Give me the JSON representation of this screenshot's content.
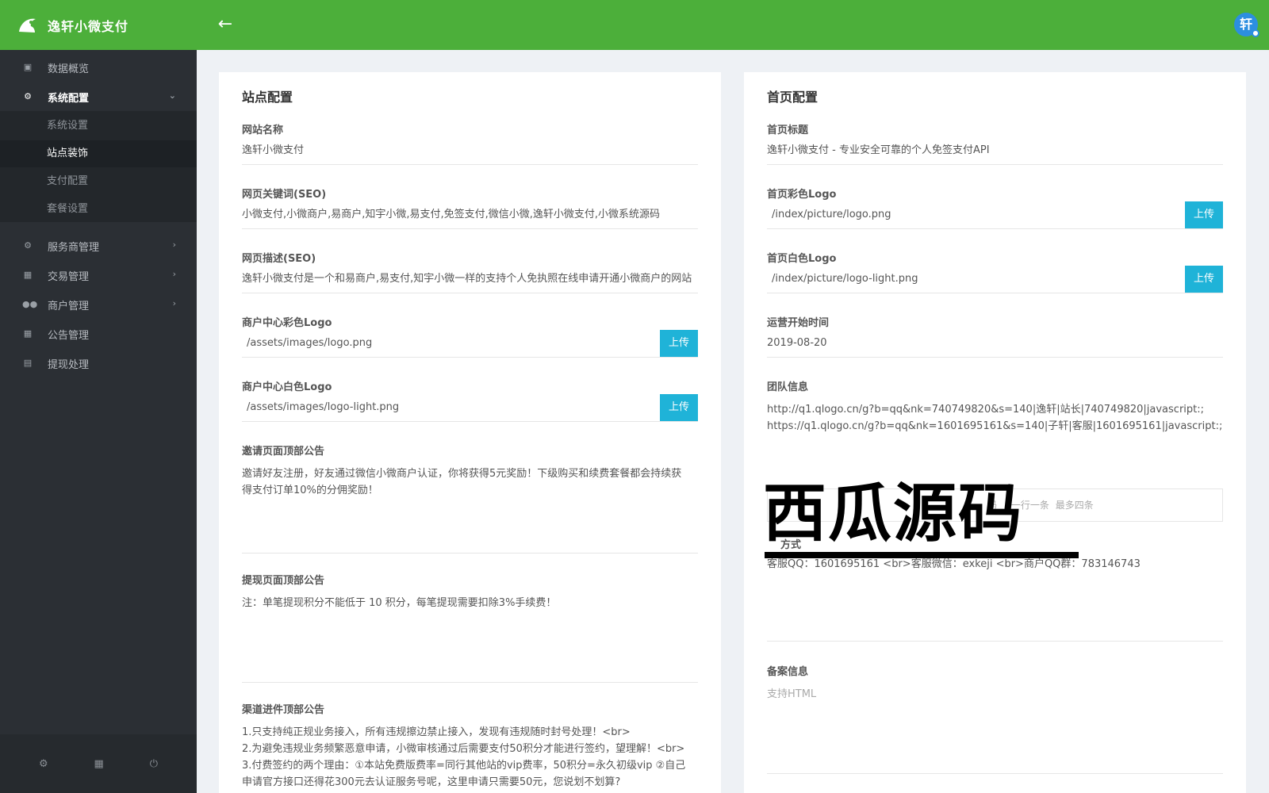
{
  "header": {
    "brand_title": "逸轩小微支付",
    "back_icon": "arrow-left-icon",
    "avatar_text": "轩"
  },
  "colors": {
    "header": "#4caf3a",
    "sidebar": "#2b2f34",
    "upload_button": "#1fb3d8"
  },
  "sidebar": {
    "items": [
      {
        "label": "数据概览",
        "icon": "window-icon"
      },
      {
        "label": "系统配置",
        "icon": "gear-icon"
      },
      {
        "label": "服务商管理",
        "icon": "gear-icon"
      },
      {
        "label": "交易管理",
        "icon": "calendar-icon"
      },
      {
        "label": "商户管理",
        "icon": "users-icon"
      },
      {
        "label": "公告管理",
        "icon": "calendar-icon"
      },
      {
        "label": "提现处理",
        "icon": "money-icon"
      }
    ],
    "submenu": [
      {
        "label": "系统设置"
      },
      {
        "label": "站点装饰"
      },
      {
        "label": "支付配置"
      },
      {
        "label": "套餐设置"
      }
    ],
    "footer": [
      "gear-icon",
      "calendar-icon",
      "power-icon"
    ]
  },
  "site_config": {
    "title": "站点配置",
    "site_name_label": "网站名称",
    "site_name_value": "逸轩小微支付",
    "keywords_label": "网页关键词(SEO)",
    "keywords_value": "小微支付,小微商户,易商户,知宇小微,易支付,免签支付,微信小微,逸轩小微支付,小微系统源码",
    "description_label": "网页描述(SEO)",
    "description_value": "逸轩小微支付是一个和易商户,易支付,知宇小微一样的支持个人免执照在线申请开通小微商户的网站",
    "color_logo_label": "商户中心彩色Logo",
    "color_logo_value": "/assets/images/logo.png",
    "white_logo_label": "商户中心白色Logo",
    "white_logo_value": "/assets/images/logo-light.png",
    "upload_label": "上传",
    "invite_label": "邀请页面顶部公告",
    "invite_line1": "邀请好友注册，好友通过微信小微商户认证，你将获得5元奖励！下级购买和续费套餐都会持续获",
    "invite_line2": "得支付订单10%的分佣奖励！",
    "withdraw_label": "提现页面顶部公告",
    "withdraw_value": "注：单笔提现积分不能低于 10 积分，每笔提现需要扣除3%手续费！",
    "channel_label": "渠道进件顶部公告",
    "channel_line1": "1.只支持纯正规业务接入，所有违规擦边禁止接入，发现有违规随时封号处理！<br>",
    "channel_line2": "2.为避免违规业务频繁恶意申请，小微审核通过后需要支付50积分才能进行签约，望理解！<br>",
    "channel_line3": "3.付费签约的两个理由：①本站免费版费率=同行其他站的vip费率，50积分=永久初级vip ②自己",
    "channel_line4": "申请官方接口还得花300元去认证服务号呢，这里申请只需要50元，您说划不划算?"
  },
  "home_config": {
    "title": "首页配置",
    "home_title_label": "首页标题",
    "home_title_value": "逸轩小微支付 - 专业安全可靠的个人免签支付API",
    "color_logo_label": "首页彩色Logo",
    "color_logo_value": "/index/picture/logo.png",
    "white_logo_label": "首页白色Logo",
    "white_logo_value": "/index/picture/logo-light.png",
    "upload_label": "上传",
    "start_label": "运营开始时间",
    "start_value": "2019-08-20",
    "team_label": "团队信息",
    "team_line1": "http://q1.qlogo.cn/g?b=qq&nk=740749820&s=140|逸轩|站长|740749820|javascript:;",
    "team_line2": "https://q1.qlogo.cn/g?b=qq&nk=1601695161&s=140|子轩|客服|1601695161|javascript:;",
    "hidden_input_fragments": [
      "码",
      "一行一条",
      "最多四条"
    ],
    "contact_label_fragment": "方式",
    "contact_value": "客服QQ：1601695161 <br>客服微信：exkeji <br>商户QQ群：783146743",
    "icp_label": "备案信息",
    "icp_placeholder": "支持HTML"
  },
  "watermark": "西瓜源码"
}
